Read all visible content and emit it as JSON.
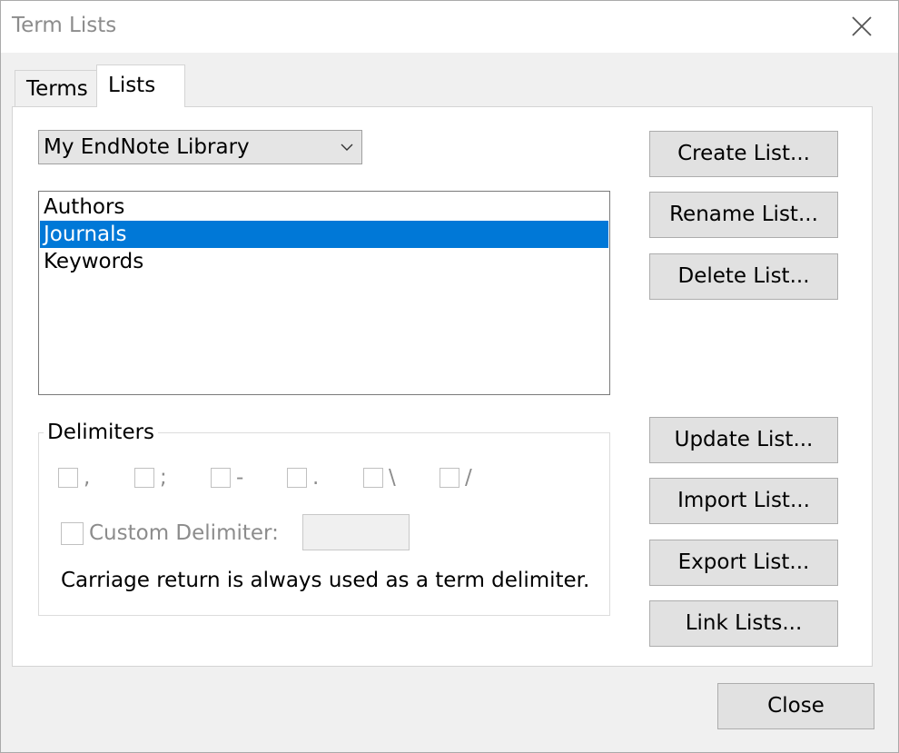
{
  "window": {
    "title": "Term Lists"
  },
  "tabs": [
    {
      "label": "Terms",
      "active": false
    },
    {
      "label": "Lists",
      "active": true
    }
  ],
  "library_select": {
    "value": "My EndNote Library"
  },
  "lists": {
    "items": [
      {
        "label": "Authors",
        "selected": false
      },
      {
        "label": "Journals",
        "selected": true
      },
      {
        "label": "Keywords",
        "selected": false
      }
    ]
  },
  "actions": {
    "create": "Create List...",
    "rename": "Rename List...",
    "delete": "Delete List...",
    "update": "Update List...",
    "import": "Import List...",
    "export": "Export List...",
    "link": "Link Lists..."
  },
  "delimiters": {
    "group_label": "Delimiters",
    "options": [
      ",",
      ";",
      "-",
      ".",
      "\\",
      "/"
    ],
    "custom_label": "Custom Delimiter:",
    "custom_value": "",
    "note": "Carriage return is always used as a term delimiter."
  },
  "footer": {
    "close": "Close"
  },
  "colors": {
    "selection": "#0078d7",
    "disabled_text": "#8c8c8c"
  }
}
